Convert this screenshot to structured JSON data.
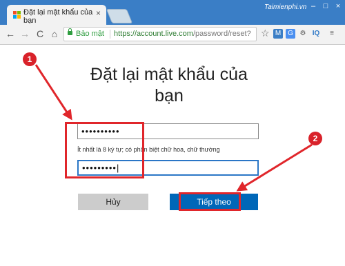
{
  "browser": {
    "tab_title": "Đặt lại mật khẩu của bạn",
    "tab_close": "×",
    "brand": "Taimienphi.vn",
    "win_minimize": "–",
    "win_maximize": "□",
    "win_close": "×",
    "back_icon": "←",
    "forward_icon": "→",
    "reload_icon": "C",
    "home_icon": "⌂",
    "secure_label": "Bảo mật",
    "url_host": "https://account.live.com",
    "url_path": "/password/reset?",
    "star_icon": "☆",
    "ext_labels": [
      "M",
      "G",
      "⚙",
      "IQ",
      "≡"
    ]
  },
  "page": {
    "heading": "Đặt lại mật khẩu của bạn",
    "password_value": "••••••••••",
    "confirm_value": "•••••••••|",
    "hint": "Ít nhất là 8 ký tự; có phân biệt chữ hoa, chữ thường",
    "cancel_label": "Hủy",
    "next_label": "Tiếp theo"
  },
  "annotations": {
    "badge1": "1",
    "badge2": "2",
    "color": "#e0262b"
  },
  "colors": {
    "accent": "#0067b8",
    "tabstrip": "#3a7ec6",
    "secure": "#2e9d3f"
  }
}
